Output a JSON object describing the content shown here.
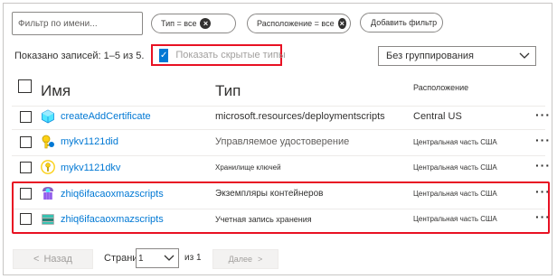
{
  "filters": {
    "name_placeholder": "Фильтр по имени...",
    "type_pill": "Тип = все",
    "location_pill": "Расположение = все",
    "add_filter_label": "Добавить фильтр"
  },
  "records_text": "Показано записей: 1–5 из 5.",
  "show_hidden_label": "Показать скрытые типы",
  "show_hidden_checked": true,
  "grouping_value": "Без группирования",
  "columns": {
    "name": "Имя",
    "type": "Тип",
    "location": "Расположение"
  },
  "rows": [
    {
      "name": "createAddCertificate",
      "type": "microsoft.resources/deploymentscripts",
      "location": "Central US",
      "icon": "deployment-script-icon",
      "more": "···"
    },
    {
      "name": "mykv1121did",
      "type": "Управляемое удостоверение",
      "location": "Центральная часть США",
      "icon": "managed-identity-icon",
      "more": "···"
    },
    {
      "name": "mykv1121dkv",
      "type": "Хранилище ключей",
      "location": "Центральная часть США",
      "icon": "key-vault-icon",
      "more": "···"
    },
    {
      "name": "zhiq6ifacaoxmazscripts",
      "type": "Экземпляры контейнеров",
      "location": "Центральная часть США",
      "icon": "container-instance-icon",
      "more": "···"
    },
    {
      "name": "zhiq6ifacaoxmazscripts",
      "type": "Учетная запись хранения",
      "location": "Центральная часть США",
      "icon": "storage-account-icon",
      "more": "···"
    }
  ],
  "pagination": {
    "prev_label": "Назад",
    "page_label": "Страница",
    "page_value": "1",
    "of_label": "из 1",
    "next_label": "Далее"
  },
  "colors": {
    "accent": "#0078d4",
    "highlight": "#e81123"
  }
}
